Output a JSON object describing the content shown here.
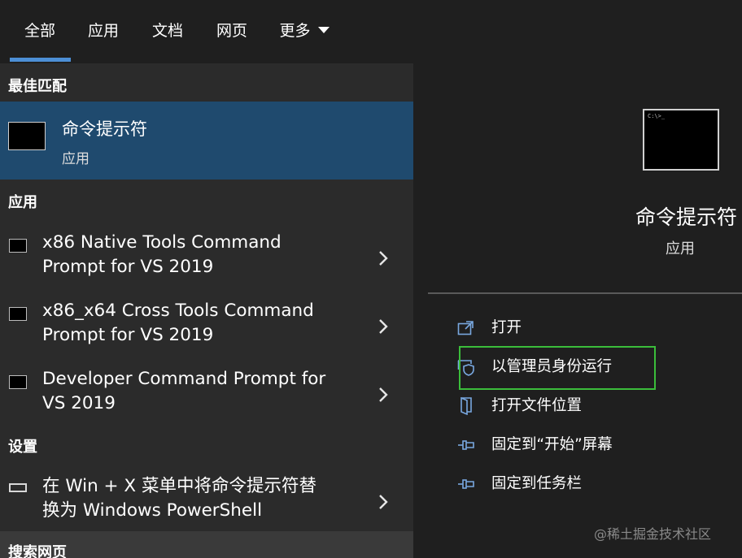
{
  "tabs": [
    {
      "label": "全部"
    },
    {
      "label": "应用"
    },
    {
      "label": "文档"
    },
    {
      "label": "网页"
    },
    {
      "label": "更多"
    }
  ],
  "sections": {
    "best_match": "最佳匹配",
    "apps": "应用",
    "settings": "设置",
    "web_search": "搜索网页"
  },
  "best_match": {
    "title": "命令提示符",
    "subtitle": "应用"
  },
  "apps": [
    {
      "line1": "x86 Native Tools Command",
      "line2": "Prompt for VS 2019"
    },
    {
      "line1": "x86_x64 Cross Tools Command",
      "line2": "Prompt for VS 2019"
    },
    {
      "line1": "Developer Command Prompt for",
      "line2": "VS 2019"
    }
  ],
  "settings_item": {
    "line1": "在 Win + X 菜单中将命令提示符替",
    "line2": "换为 Windows PowerShell"
  },
  "detail": {
    "title": "命令提示符",
    "subtitle": "应用",
    "preview_glyph": "C:\\>_",
    "actions": [
      {
        "label": "打开",
        "icon": "open-icon"
      },
      {
        "label": "以管理员身份运行",
        "icon": "shield-icon"
      },
      {
        "label": "打开文件位置",
        "icon": "file-location-icon"
      },
      {
        "label": "固定到“开始”屏幕",
        "icon": "pin-icon"
      },
      {
        "label": "固定到任务栏",
        "icon": "pin-icon"
      }
    ]
  },
  "watermark": "@稀土掘金技术社区",
  "colors": {
    "accent": "#4c8fd6",
    "selected_bg": "#1f4a6e",
    "highlight_box": "#3bbd3b"
  }
}
